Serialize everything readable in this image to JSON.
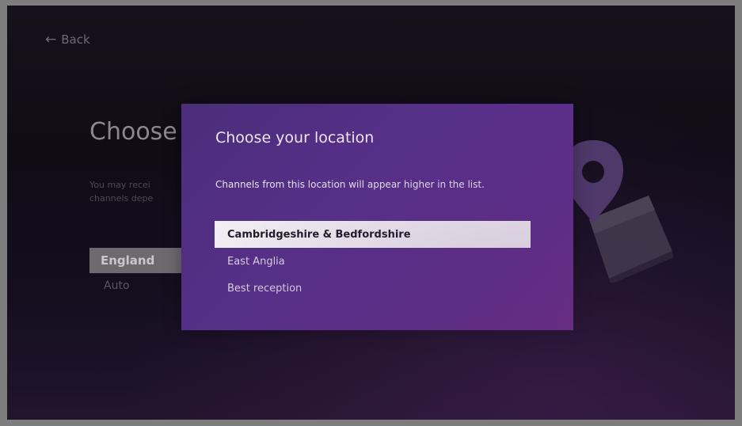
{
  "back": {
    "label": "Back",
    "icon": "arrow-left-icon"
  },
  "background": {
    "title": "Choose",
    "description": "You may recei\nchannels depe",
    "list": [
      {
        "label": "England",
        "selected": true
      },
      {
        "label": "Auto",
        "selected": false
      }
    ]
  },
  "dialog": {
    "title": "Choose your location",
    "description": "Channels from this location will appear higher in the list.",
    "options": [
      {
        "label": "Cambridgeshire & Bedfordshire",
        "selected": true
      },
      {
        "label": "East Anglia",
        "selected": false
      },
      {
        "label": "Best reception",
        "selected": false
      }
    ]
  },
  "decoration": {
    "icon": "location-pin-map-icon"
  },
  "colors": {
    "background": "#140f1c",
    "dialog": "#57308a",
    "highlight": "#f3f1f5"
  }
}
